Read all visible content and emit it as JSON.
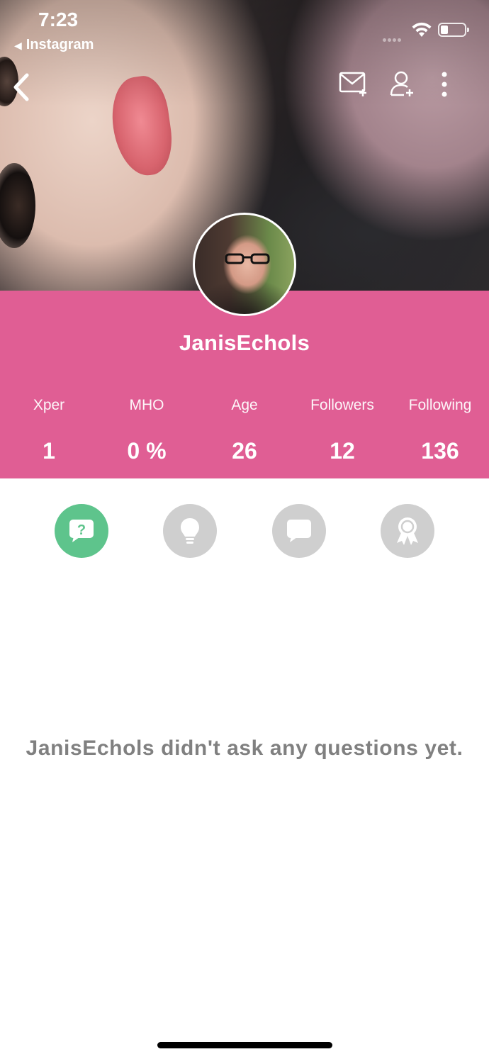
{
  "status_bar": {
    "time": "7:23",
    "back_app": "Instagram"
  },
  "profile": {
    "username": "JanisEchols"
  },
  "stats": [
    {
      "label": "Xper",
      "value": "1"
    },
    {
      "label": "MHO",
      "value": "0 %"
    },
    {
      "label": "Age",
      "value": "26"
    },
    {
      "label": "Followers",
      "value": "12"
    },
    {
      "label": "Following",
      "value": "136"
    }
  ],
  "tabs": [
    {
      "name": "questions",
      "icon": "question-bubble-icon",
      "active": true
    },
    {
      "name": "tips",
      "icon": "lightbulb-icon",
      "active": false
    },
    {
      "name": "opinions",
      "icon": "speech-bubble-icon",
      "active": false
    },
    {
      "name": "badges",
      "icon": "award-ribbon-icon",
      "active": false
    }
  ],
  "empty_state": {
    "message": "JanisEchols didn't ask any questions yet."
  },
  "colors": {
    "band": "#e05e94",
    "tab_active": "#5ec48c",
    "tab_inactive": "#cfcfcf",
    "empty_text": "#808080"
  }
}
